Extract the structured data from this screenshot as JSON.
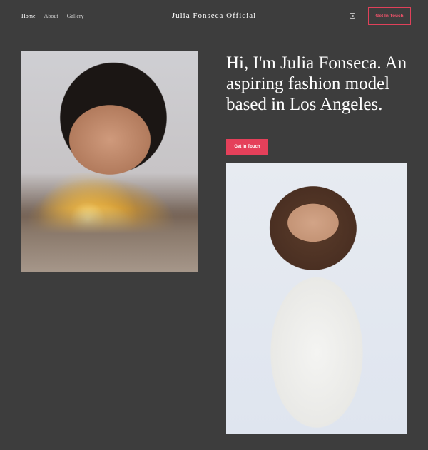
{
  "header": {
    "nav": [
      {
        "label": "Home",
        "active": true
      },
      {
        "label": "About",
        "active": false
      },
      {
        "label": "Gallery",
        "active": false
      }
    ],
    "site_title": "Julia Fonseca Official",
    "social_icon": "instagram-icon",
    "cta_label": "Get In Touch"
  },
  "hero": {
    "headline": "Hi, I'm Julia Fonseca. An aspiring fashion model based in Los Angeles.",
    "cta_label": "Get In Touch"
  },
  "colors": {
    "background": "#3d3d3d",
    "accent": "#e5405a",
    "text": "#ffffff"
  }
}
